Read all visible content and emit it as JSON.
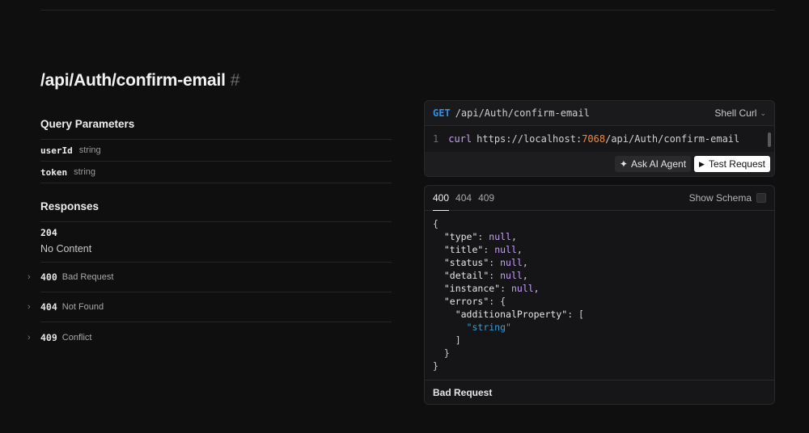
{
  "endpoint": {
    "title": "/api/Auth/confirm-email",
    "anchor": "#"
  },
  "query": {
    "heading": "Query Parameters",
    "params": [
      {
        "name": "userId",
        "type": "string"
      },
      {
        "name": "token",
        "type": "string"
      }
    ]
  },
  "responses": {
    "heading": "Responses",
    "primary": {
      "code": "204",
      "desc": "No Content"
    },
    "items": [
      {
        "code": "400",
        "desc": "Bad Request"
      },
      {
        "code": "404",
        "desc": "Not Found"
      },
      {
        "code": "409",
        "desc": "Conflict"
      }
    ]
  },
  "request": {
    "method": "GET",
    "path": "/api/Auth/confirm-email",
    "language": "Shell Curl",
    "line_number": "1",
    "command": "curl",
    "url_prefix": "https://localhost:",
    "url_port": "7068",
    "url_suffix": "/api/Auth/confirm-email",
    "ask_ai_label": "Ask AI Agent",
    "test_label": "Test Request"
  },
  "response_panel": {
    "tabs": [
      "400",
      "404",
      "409"
    ],
    "active_tab": "400",
    "show_schema_label": "Show Schema",
    "json_lines": [
      "{",
      "  \"type\": null,",
      "  \"title\": null,",
      "  \"status\": null,",
      "  \"detail\": null,",
      "  \"instance\": null,",
      "  \"errors\": {",
      "    \"additionalProperty\": [",
      "      \"string\"",
      "    ]",
      "  }",
      "}"
    ],
    "footer": "Bad Request"
  },
  "colors": {
    "background": "#0f0f10",
    "method": "#2f8fe8",
    "keyword": "#c6a0f6",
    "port": "#f0883e",
    "string": "#2f9fe0"
  }
}
